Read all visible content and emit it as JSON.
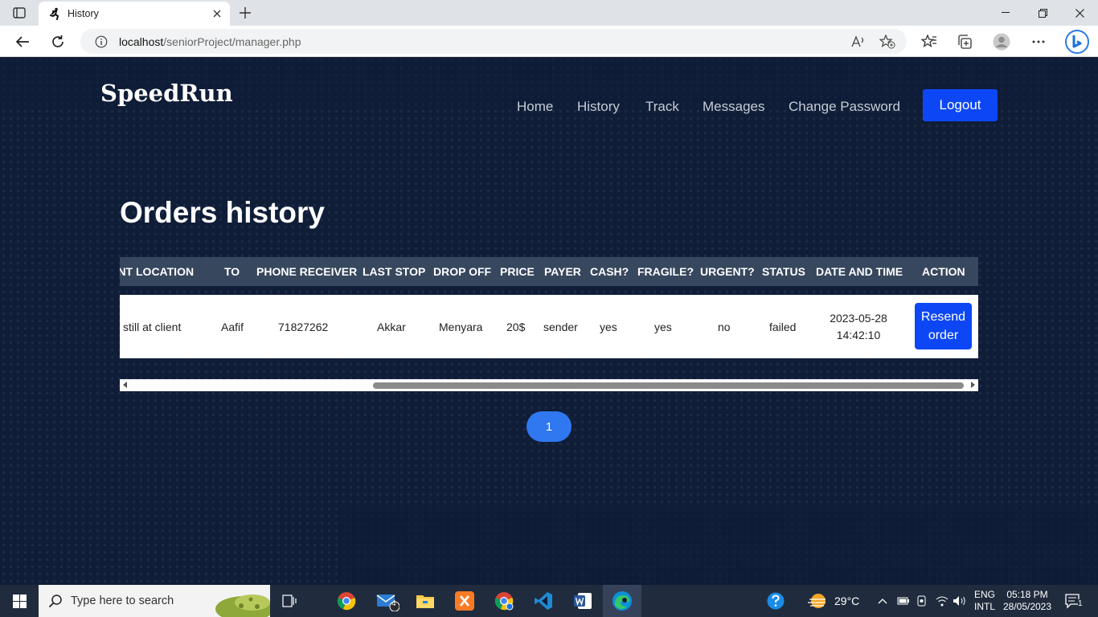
{
  "browser": {
    "tab_title": "History",
    "url_host": "localhost",
    "url_path": "/seniorProject/manager.php"
  },
  "site": {
    "brand": "SpeedRun",
    "nav": [
      "Home",
      "History",
      "Track",
      "Messages",
      "Change Password"
    ],
    "logout_label": "Logout"
  },
  "main": {
    "heading": "Orders history",
    "columns": [
      "RENT LOCATION",
      "TO",
      "PHONE RECEIVER",
      "LAST STOP",
      "DROP OFF",
      "PRICE",
      "PAYER",
      "CASH?",
      "FRAGILE?",
      "URGENT?",
      "STATUS",
      "DATE AND TIME",
      "ACTION"
    ],
    "rows": [
      {
        "current_location": "still at client",
        "to": "Aafif",
        "phone_receiver": "71827262",
        "last_stop": "Akkar",
        "drop_off": "Menyara",
        "price": "20$",
        "payer": "sender",
        "cash": "yes",
        "fragile": "yes",
        "urgent": "no",
        "status": "failed",
        "date": "2023-05-28",
        "time": "14:42:10",
        "action_label": "Resend order"
      }
    ],
    "pagination": {
      "current_page": "1"
    }
  },
  "taskbar": {
    "search_placeholder": "Type here to search",
    "mail_badge": "4",
    "temperature": "29°C",
    "language_1": "ENG",
    "language_2": "INTL",
    "time": "05:18 PM",
    "date": "28/05/2023",
    "notification_count": "1"
  },
  "colors": {
    "page_bg": "#0f1d37",
    "primary_button": "#0d47f5",
    "table_header": "#37475e",
    "pagination": "#2f78f0"
  }
}
